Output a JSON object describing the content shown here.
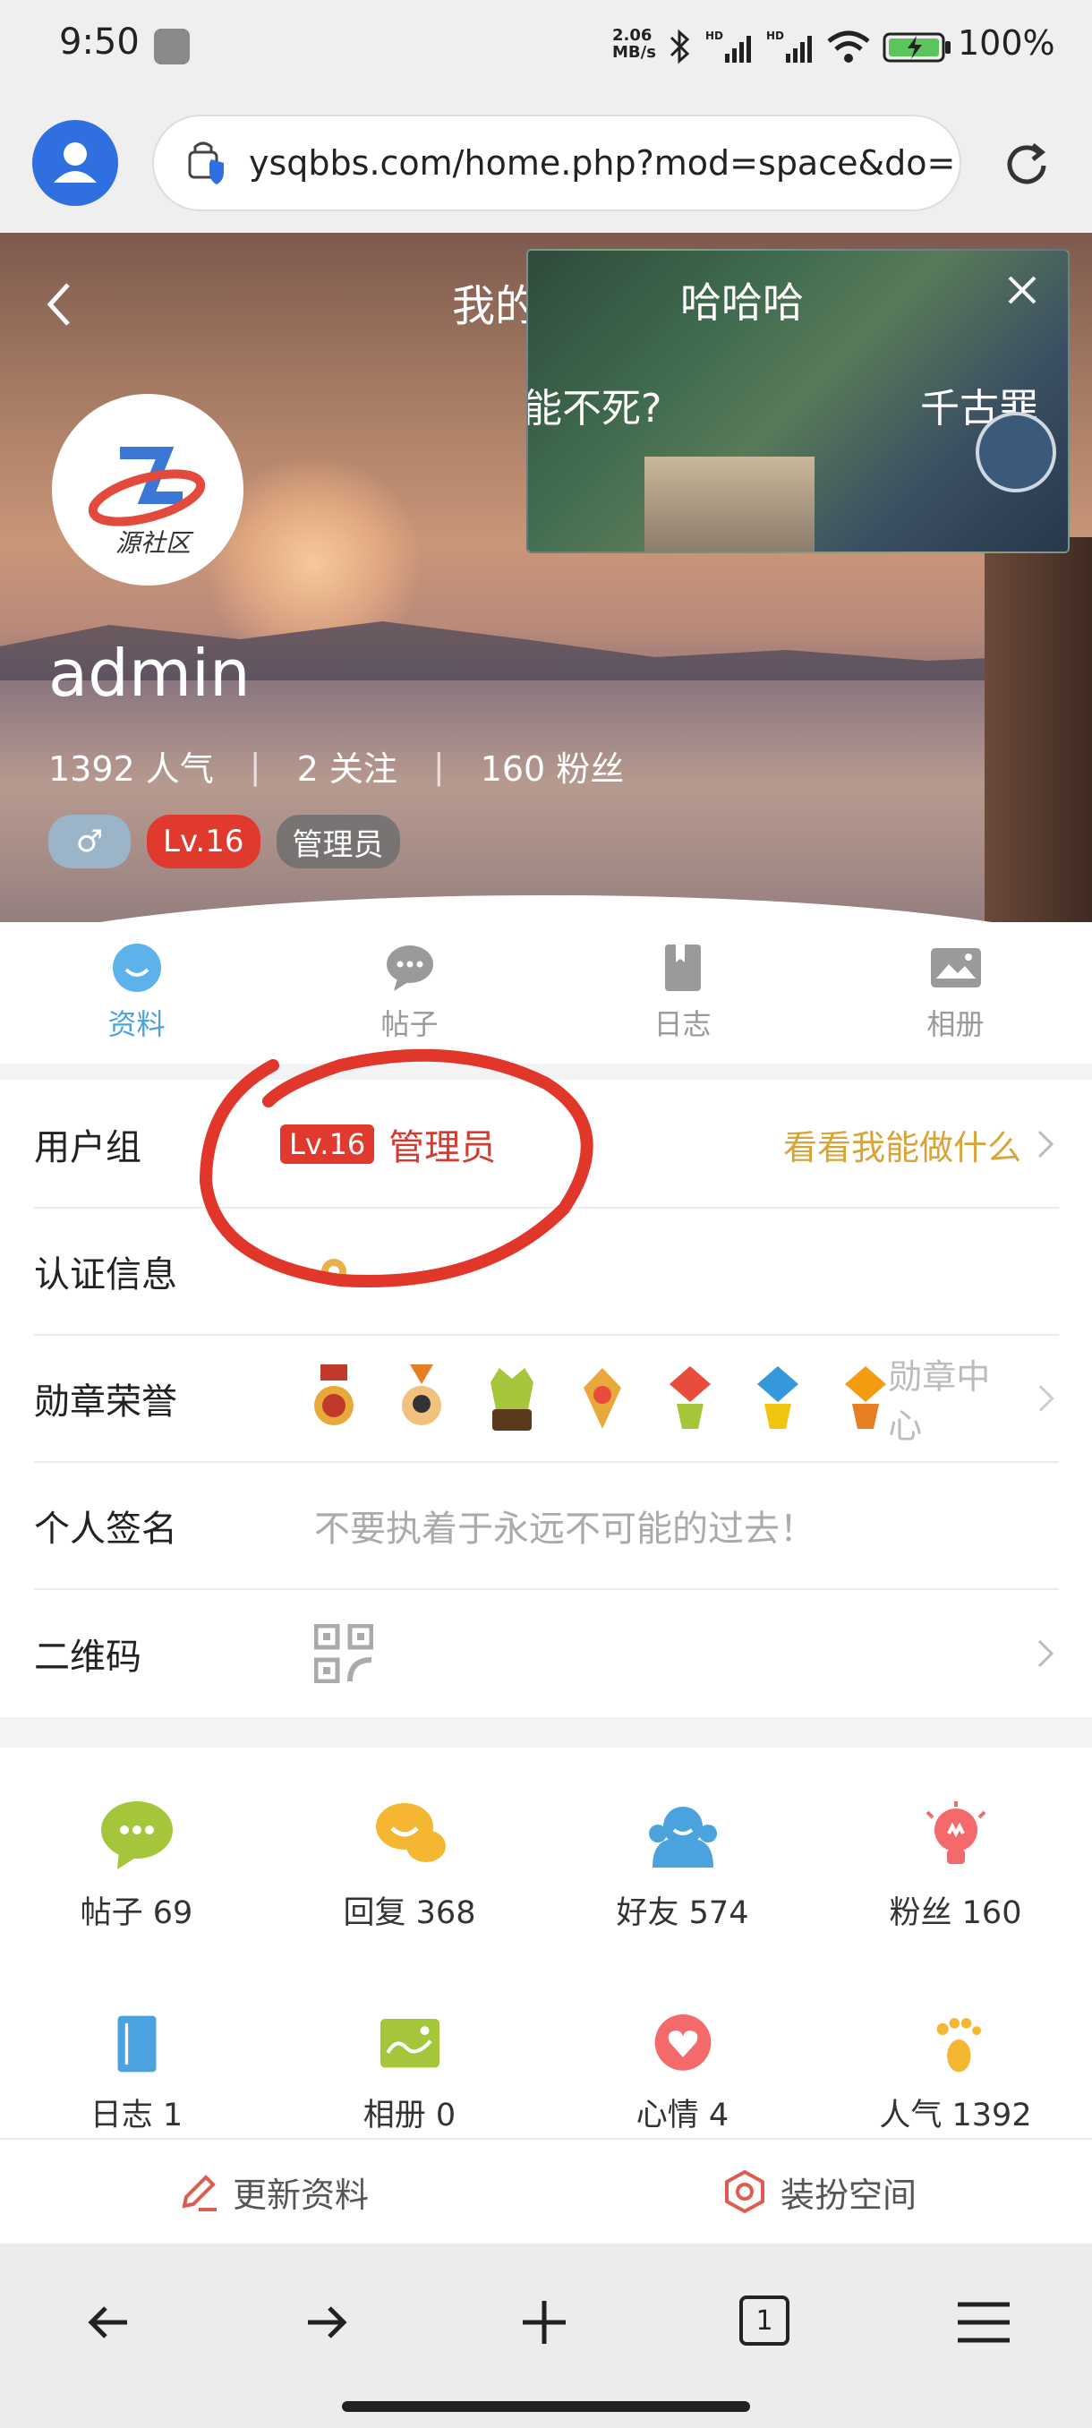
{
  "status_bar": {
    "time": "9:50",
    "net_speed": "2.06\nMB/s",
    "battery": "100%"
  },
  "browser": {
    "url": "ysqbbs.com/home.php?mod=space&do=",
    "tab_count": "1"
  },
  "header": {
    "title": "我的土鸡",
    "overlay_text": "哈哈哈"
  },
  "video": {
    "caption_left": "能不死?",
    "caption_right": "千古罪"
  },
  "profile": {
    "logo_text": "源社区",
    "username": "admin",
    "popularity": "1392 人气",
    "following": "2 关注",
    "fans": "160 粉丝",
    "gender": "♂",
    "level": "Lv.16",
    "role": "管理员"
  },
  "tabs": [
    {
      "label": "资料"
    },
    {
      "label": "帖子"
    },
    {
      "label": "日志"
    },
    {
      "label": "相册"
    }
  ],
  "info": {
    "user_group": {
      "key": "用户组",
      "level": "Lv.16",
      "role": "管理员",
      "link": "看看我能做什么"
    },
    "verify": {
      "key": "认证信息"
    },
    "medals": {
      "key": "勋章荣誉",
      "link": "勋章中心"
    },
    "signature": {
      "key": "个人签名",
      "value": "不要执着于永远不可能的过去！"
    },
    "qrcode": {
      "key": "二维码"
    }
  },
  "stats": [
    {
      "label": "帖子 69",
      "icon": "chat-bubble-icon",
      "color": "#a5c63b"
    },
    {
      "label": "回复 368",
      "icon": "reply-bubble-icon",
      "color": "#f5b731"
    },
    {
      "label": "好友 574",
      "icon": "friends-icon",
      "color": "#4aa3df"
    },
    {
      "label": "粉丝 160",
      "icon": "lightbulb-icon",
      "color": "#f46a6a"
    },
    {
      "label": "日志 1",
      "icon": "book-icon",
      "color": "#4aa3df"
    },
    {
      "label": "相册 0",
      "icon": "photo-icon",
      "color": "#a5c63b"
    },
    {
      "label": "心情 4",
      "icon": "heart-bubble-icon",
      "color": "#f46a6a"
    },
    {
      "label": "人气 1392",
      "icon": "footprint-icon",
      "color": "#f5b731"
    }
  ],
  "bottom_actions": {
    "edit": "更新资料",
    "decorate": "装扮空间"
  },
  "colors": {
    "accent": "#4aa3df",
    "level_red": "#e03a2f",
    "link_gold": "#d9a437",
    "annotation_red": "#e0372a"
  }
}
